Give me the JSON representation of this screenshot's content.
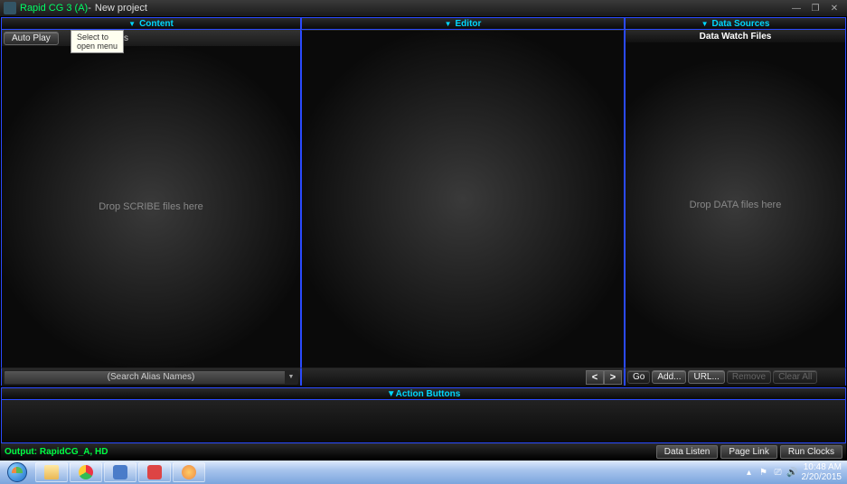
{
  "window": {
    "app_title": "Rapid CG 3 (A)",
    "separator": "  -  ",
    "project": "New project"
  },
  "panels": {
    "content": {
      "title": "Content",
      "autoplay_btn": "Auto Play",
      "seconds": "seconds",
      "tooltip": "Select to\nopen menu",
      "drop_hint": "Drop SCRIBE files here",
      "search_placeholder": "(Search Alias Names)"
    },
    "editor": {
      "title": "Editor",
      "nav_prev": "<",
      "nav_next": ">"
    },
    "data": {
      "title": "Data Sources",
      "subtitle": "Data Watch Files",
      "drop_hint": "Drop DATA files here",
      "buttons": {
        "go": "Go",
        "add": "Add...",
        "url": "URL...",
        "remove": "Remove",
        "clear": "Clear All"
      }
    },
    "action": {
      "title": "Action Buttons"
    }
  },
  "status": {
    "output": "Output: RapidCG_A, HD",
    "data_listen": "Data Listen",
    "page_link": "Page Link",
    "run_clocks": "Run Clocks"
  },
  "taskbar": {
    "time": "10:48 AM",
    "date": "2/20/2015"
  }
}
